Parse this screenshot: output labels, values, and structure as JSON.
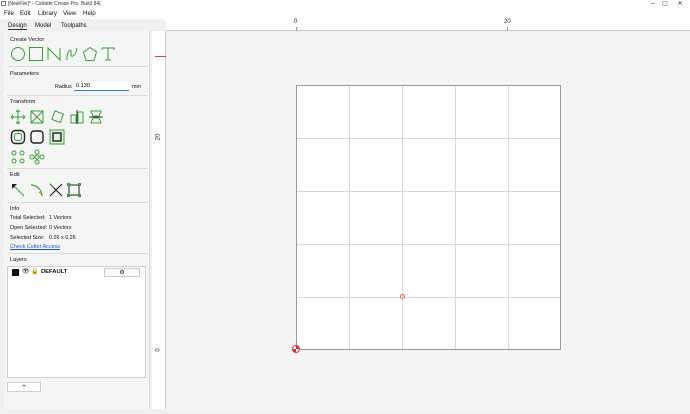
{
  "window": {
    "title": "[NewFile]* - Carbide Create Pro, Build 84]",
    "min": "–",
    "max": "▢",
    "close": "✕"
  },
  "menu": [
    "File",
    "Edit",
    "Library",
    "View",
    "Help"
  ],
  "tabs": [
    "Design",
    "Model",
    "Toolpaths"
  ],
  "create_vector": {
    "title": "Create Vector",
    "icons": [
      "circle-icon",
      "rectangle-icon",
      "polyline-icon",
      "curve-icon",
      "polygon-icon",
      "text-icon"
    ]
  },
  "parameters": {
    "title": "Parameters",
    "radius_label": "Radius",
    "radius_value": "0.130",
    "unit": "mm"
  },
  "transform": {
    "title": "Transform",
    "row1": [
      "move-icon",
      "scale-icon",
      "rotate-icon",
      "align-icon",
      "mirror-icon"
    ],
    "row2": [
      "offset-icon",
      "fillet-icon",
      "boolean-icon"
    ],
    "row3": [
      "circular-array-icon",
      "rectangular-array-icon"
    ]
  },
  "edit": {
    "title": "Edit",
    "icons": [
      "node-edit-icon",
      "curve-edit-icon",
      "trim-icon",
      "bbox-edit-icon"
    ]
  },
  "info": {
    "title": "Info",
    "total_selected_label": "Total Selected:",
    "total_selected_value": "1 Vectors",
    "open_selected_label": "Open Selected:",
    "open_selected_value": "0 Vectors",
    "selected_size_label": "Selected Size:",
    "selected_size_value": "0.26 x 0.26",
    "cutter_link": "Check Cutter Access"
  },
  "layers": {
    "title": "Layers",
    "items": [
      {
        "name": "DEFAULT",
        "color": "#111111"
      }
    ],
    "add_label": "+"
  },
  "rulers": {
    "top_labels": [
      "0",
      "20"
    ],
    "left_labels": [
      "20",
      "0"
    ]
  },
  "colors": {
    "accent": "#3a9e3a",
    "link": "#1a55c9",
    "origin": "#d33",
    "ruler_red": "#e04040"
  }
}
